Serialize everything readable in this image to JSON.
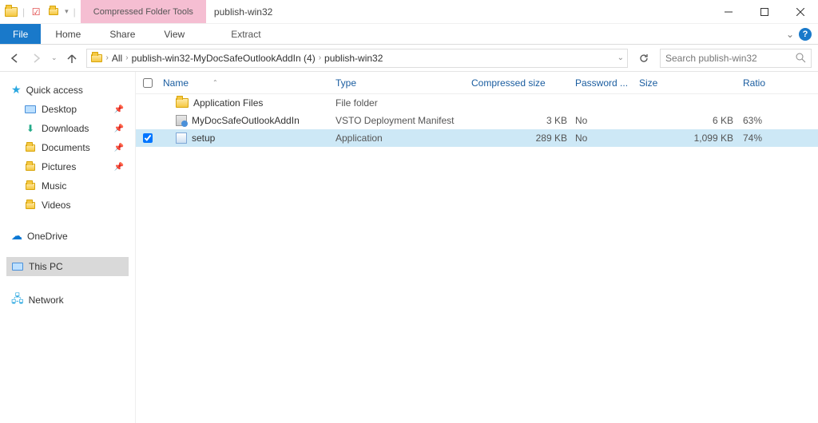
{
  "window": {
    "context_tab": "Compressed Folder Tools",
    "title": "publish-win32"
  },
  "ribbon": {
    "file": "File",
    "home": "Home",
    "share": "Share",
    "view": "View",
    "extract": "Extract"
  },
  "nav": {
    "breadcrumb": [
      "All",
      "publish-win32-MyDocSafeOutlookAddIn (4)",
      "publish-win32"
    ],
    "search_placeholder": "Search publish-win32"
  },
  "sidebar": {
    "quick_access": "Quick access",
    "desktop": "Desktop",
    "downloads": "Downloads",
    "documents": "Documents",
    "pictures": "Pictures",
    "music": "Music",
    "videos": "Videos",
    "onedrive": "OneDrive",
    "thispc": "This PC",
    "network": "Network"
  },
  "columns": {
    "name": "Name",
    "type": "Type",
    "compressed": "Compressed size",
    "password": "Password ...",
    "size": "Size",
    "ratio": "Ratio"
  },
  "rows": [
    {
      "checked": false,
      "name": "Application Files",
      "type": "File folder",
      "compressed": "",
      "password": "",
      "size": "",
      "ratio": "",
      "selected": false,
      "icon": "folder"
    },
    {
      "checked": false,
      "name": "MyDocSafeOutlookAddIn",
      "type": "VSTO Deployment Manifest",
      "compressed": "3 KB",
      "password": "No",
      "size": "6 KB",
      "ratio": "63%",
      "selected": false,
      "icon": "vsto"
    },
    {
      "checked": true,
      "name": "setup",
      "type": "Application",
      "compressed": "289 KB",
      "password": "No",
      "size": "1,099 KB",
      "ratio": "74%",
      "selected": true,
      "icon": "app"
    }
  ]
}
